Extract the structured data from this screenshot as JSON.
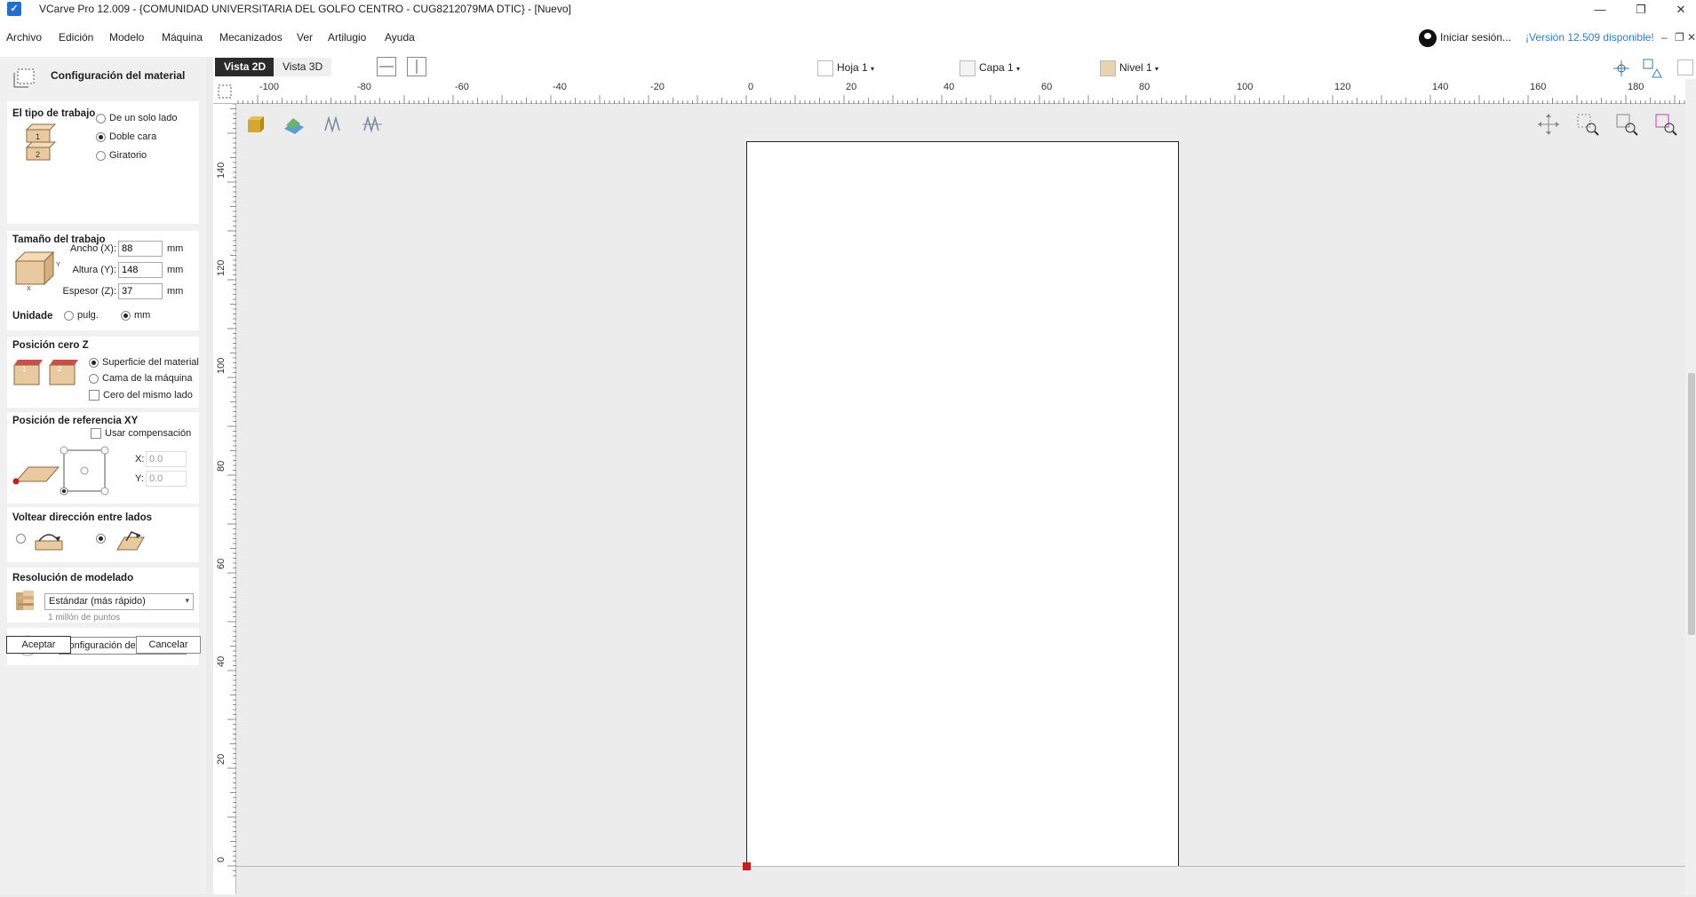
{
  "app": {
    "title": "VCarve Pro 12.009 - {COMUNIDAD UNIVERSITARIA DEL GOLFO CENTRO - CUG8212079MA DTIC} - [Nuevo]",
    "window_controls": [
      "—",
      "❐",
      "✕"
    ]
  },
  "menu": {
    "items": [
      "Archivo",
      "Edición",
      "Modelo",
      "Máquina",
      "Mecanizados",
      "Ver",
      "Artilugio",
      "Ayuda"
    ],
    "login": "Iniciar sesión...",
    "version_notice": "¡Versión 12.509 disponible!",
    "mdi_controls": [
      "–",
      "❐",
      "✕"
    ]
  },
  "toolbar": {
    "tab_2d": "Vista 2D",
    "tab_3d": "Vista 3D",
    "sheet_label": "Hoja 1",
    "layer_label": "Capa 1",
    "level_label": "Nivel 1",
    "dropdown_arrow": "▾"
  },
  "panel": {
    "title": "Configuración del material",
    "job_type": {
      "heading": "El tipo de trabajo",
      "options": [
        "De un solo lado",
        "Doble cara",
        "Giratorio"
      ],
      "selected": "Doble cara"
    },
    "job_size": {
      "heading": "Tamaño del trabajo",
      "width_label": "Ancho (X):",
      "width_value": "88",
      "height_label": "Altura (Y):",
      "height_value": "148",
      "thickness_label": "Espesor (Z):",
      "thickness_value": "37",
      "unit_suffix": "mm"
    },
    "units": {
      "heading": "Unidade",
      "options": [
        "pulg.",
        "mm"
      ],
      "selected": "mm"
    },
    "z_zero": {
      "heading": "Posición cero Z",
      "options": [
        "Superficie del material",
        "Cama de la máquina"
      ],
      "selected": "Superficie del material",
      "same_side_label": "Cero del mismo lado"
    },
    "xy_ref": {
      "heading": "Posición de referencia XY",
      "offset_label": "Usar compensación",
      "x_label": "X:",
      "x_value": "0.0",
      "y_label": "Y:",
      "y_value": "0.0"
    },
    "flip": {
      "heading": "Voltear dirección entre lados"
    },
    "resolution": {
      "heading": "Resolución de modelado",
      "selected": "Estándar (más rápido)",
      "points_note": "1 millón de puntos"
    },
    "materials_button": "Configuración de materiales",
    "ok_button": "Aceptar",
    "cancel_button": "Cancelar"
  },
  "rulers": {
    "top_labels": [
      "-100",
      "-80",
      "-60",
      "-40",
      "-20",
      "0",
      "20",
      "40",
      "60",
      "80",
      "100",
      "120",
      "140",
      "160",
      "180"
    ],
    "left_labels": [
      "140",
      "120",
      "100",
      "80",
      "60",
      "40",
      "20",
      "0"
    ]
  },
  "colors": {
    "accent_link": "#2a7fd4",
    "origin_marker": "#c81e1e",
    "active_tab": "#2b2b2b",
    "material_tan": "#e8c9a0"
  }
}
